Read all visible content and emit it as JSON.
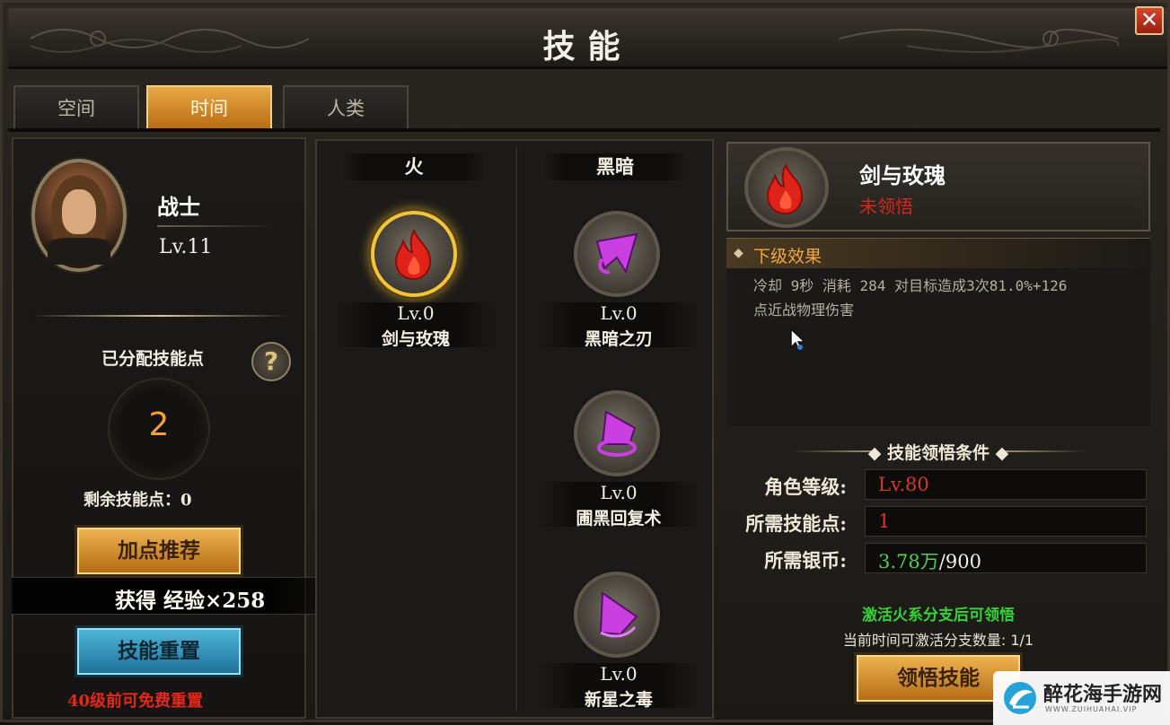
{
  "window": {
    "title": "技能"
  },
  "tabs": [
    {
      "label": "空间",
      "active": false
    },
    {
      "label": "时间",
      "active": true
    },
    {
      "label": "人类",
      "active": false
    }
  ],
  "character": {
    "class_name": "战士",
    "level": "Lv.11",
    "assigned_points_label": "已分配技能点",
    "assigned_points": "2",
    "remaining_points": "剩余技能点：0",
    "recommend_button": "加点推荐",
    "exp_reward": "获得 经验×258",
    "reset_button": "技能重置",
    "reset_hint": "40级前可免费重置"
  },
  "skill_tree": {
    "branches": [
      {
        "name": "火",
        "skills": [
          {
            "level": "Lv.0",
            "name": "剑与玫瑰",
            "icon": "fire-icon",
            "selected": true
          }
        ]
      },
      {
        "name": "黑暗",
        "skills": [
          {
            "level": "Lv.0",
            "name": "黑暗之刃",
            "icon": "dark-blade-icon",
            "selected": false
          },
          {
            "level": "Lv.0",
            "name": "圃黑回复术",
            "icon": "dark-heal-icon",
            "selected": false
          },
          {
            "level": "Lv.0",
            "name": "新星之毒",
            "icon": "nova-poison-icon",
            "selected": false
          }
        ]
      }
    ]
  },
  "detail": {
    "skill_name": "剑与玫瑰",
    "status": "未领悟",
    "effect_title": "下级效果",
    "effect_desc_line1": "冷却 9秒 消耗 284 对目标造成3次81.0%+126",
    "effect_desc_line2": "点近战物理伤害",
    "conditions_title": "技能领悟条件",
    "conditions": [
      {
        "label": "角色等级:",
        "value": "Lv.80",
        "color": "red"
      },
      {
        "label": "所需技能点:",
        "value": "1",
        "color": "red"
      },
      {
        "label": "所需银币:",
        "value_have": "3.78万",
        "value_need": "/900",
        "color": "green"
      }
    ],
    "activate_hint": "激活火系分支后可领悟",
    "branch_count": "当前时间可激活分支数量: 1/1",
    "learn_button": "领悟技能"
  },
  "watermark": {
    "title": "醉花海手游网",
    "url": "WWW.ZUIHUAHAI.VIP"
  },
  "colors": {
    "accent_orange": "#f0b553",
    "accent_blue": "#4fb7d9",
    "status_red": "#d9271b",
    "status_green": "#4fd046",
    "fire_red": "#e0231a",
    "dark_purple": "#c93fe0"
  }
}
